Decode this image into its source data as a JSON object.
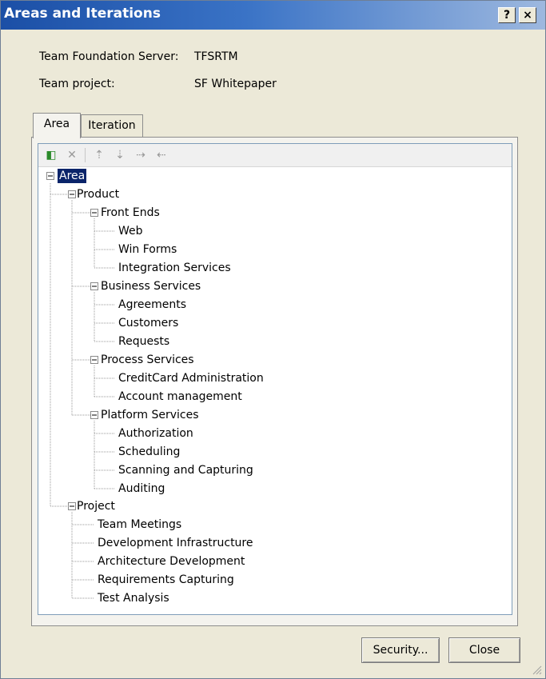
{
  "window": {
    "title": "Areas and Iterations",
    "help_label": "?",
    "close_label": "×"
  },
  "info": {
    "server_label": "Team Foundation Server:",
    "server_value": "TFSRTM",
    "project_label": "Team project:",
    "project_value": "SF Whitepaper"
  },
  "tabs": [
    {
      "label": "Area",
      "active": true
    },
    {
      "label": "Iteration",
      "active": false
    }
  ],
  "toolbar": {
    "icons": [
      "new-node-icon",
      "delete-icon",
      "move-up-icon",
      "move-down-icon",
      "demote-icon",
      "promote-icon"
    ]
  },
  "tree": {
    "expander_symbol": "−",
    "root": "Area",
    "product": "Product",
    "front_ends": "Front Ends",
    "web": "Web",
    "win_forms": "Win Forms",
    "integration_services": "Integration Services",
    "business_services": "Business Services",
    "agreements": "Agreements",
    "customers": "Customers",
    "requests": "Requests",
    "process_services": "Process Services",
    "creditcard_administration": "CreditCard Administration",
    "account_management": "Account management",
    "platform_services": "Platform Services",
    "authorization": "Authorization",
    "scheduling": "Scheduling",
    "scanning_capturing": "Scanning and Capturing",
    "auditing": "Auditing",
    "project": "Project",
    "team_meetings": "Team Meetings",
    "development_infrastructure": "Development Infrastructure",
    "architecture_development": "Architecture Development",
    "requirements_capturing": "Requirements Capturing",
    "test_analysis": "Test Analysis"
  },
  "buttons": {
    "security": "Security...",
    "close": "Close"
  }
}
